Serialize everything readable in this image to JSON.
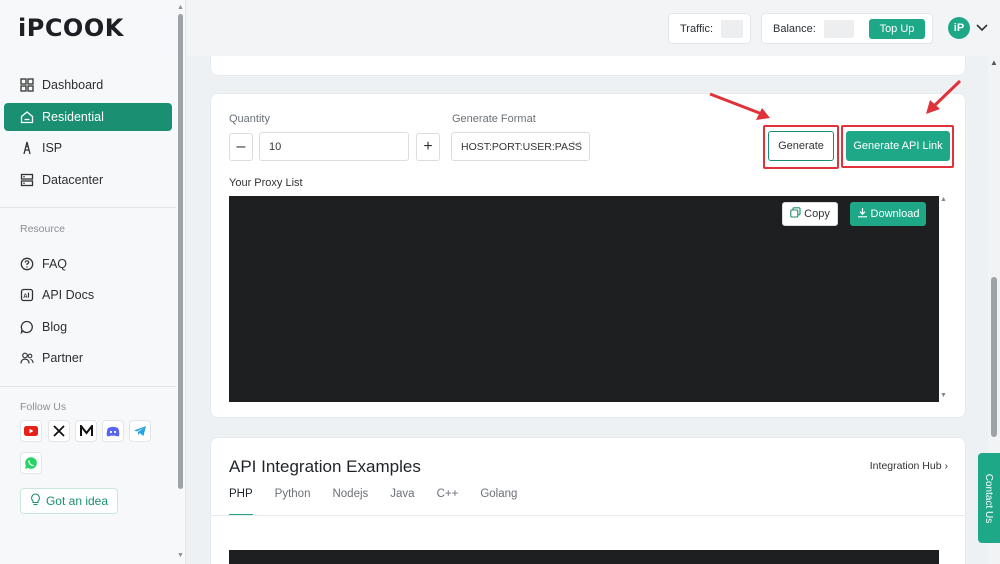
{
  "brand": {
    "logo_text": "iPCOOK"
  },
  "sidebar": {
    "items": [
      {
        "label": "Dashboard",
        "icon": "grid-icon"
      },
      {
        "label": "Residential",
        "icon": "home-icon",
        "active": true
      },
      {
        "label": "ISP",
        "icon": "tower-icon"
      },
      {
        "label": "Datacenter",
        "icon": "server-icon"
      }
    ],
    "resource_label": "Resource",
    "resource_items": [
      {
        "label": "FAQ",
        "icon": "question-icon"
      },
      {
        "label": "API Docs",
        "icon": "api-icon"
      },
      {
        "label": "Blog",
        "icon": "chat-icon"
      },
      {
        "label": "Partner",
        "icon": "people-icon"
      }
    ],
    "follow_label": "Follow Us",
    "idea_label": "Got an idea"
  },
  "topbar": {
    "traffic_label": "Traffic:",
    "balance_label": "Balance:",
    "topup_label": "Top Up"
  },
  "generator": {
    "quantity_label": "Quantity",
    "quantity_value": "10",
    "format_label": "Generate Format",
    "format_value": "HOST:PORT:USER:PASS",
    "generate_label": "Generate",
    "api_link_label": "Generate API Link",
    "proxy_list_label": "Your Proxy List",
    "copy_label": "Copy",
    "download_label": "Download"
  },
  "api_examples": {
    "title": "API Integration Examples",
    "hub_link": "Integration Hub",
    "tabs": [
      "PHP",
      "Python",
      "Nodejs",
      "Java",
      "C++",
      "Golang"
    ]
  },
  "contact_label": "Contact Us",
  "colors": {
    "brand_green": "#1ea888",
    "active_green": "#1a8f72",
    "highlight_red": "#e0323a"
  }
}
